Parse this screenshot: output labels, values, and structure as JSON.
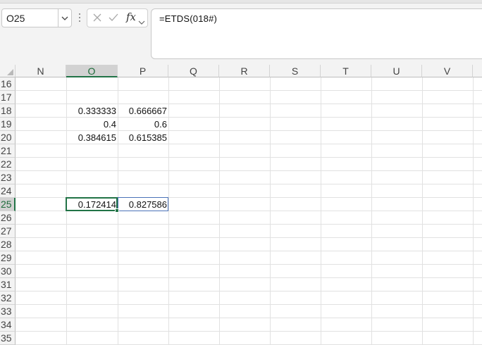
{
  "name_box": {
    "value": "O25"
  },
  "formula_bar": {
    "cancel_icon": "close-icon",
    "enter_icon": "check-icon",
    "fx_label": "fx",
    "formula": "=ETDS(018#)"
  },
  "grid": {
    "columns": [
      "N",
      "O",
      "P",
      "Q",
      "R",
      "S",
      "T",
      "U",
      "V"
    ],
    "selected_column": "O",
    "rows": [
      "16",
      "17",
      "18",
      "19",
      "20",
      "21",
      "22",
      "23",
      "24",
      "25",
      "26",
      "27",
      "28",
      "29",
      "30",
      "31",
      "32",
      "33",
      "34",
      "35"
    ],
    "selected_row": "25",
    "cells": {
      "O18": "0.333333",
      "P18": "0.666667",
      "O19": "0.4",
      "P19": "0.6",
      "O20": "0.384615",
      "P20": "0.615385",
      "O25": "0.172414",
      "P25": "0.827586"
    }
  },
  "colors": {
    "accent": "#217346",
    "selection_outline": "#4a72b8"
  }
}
